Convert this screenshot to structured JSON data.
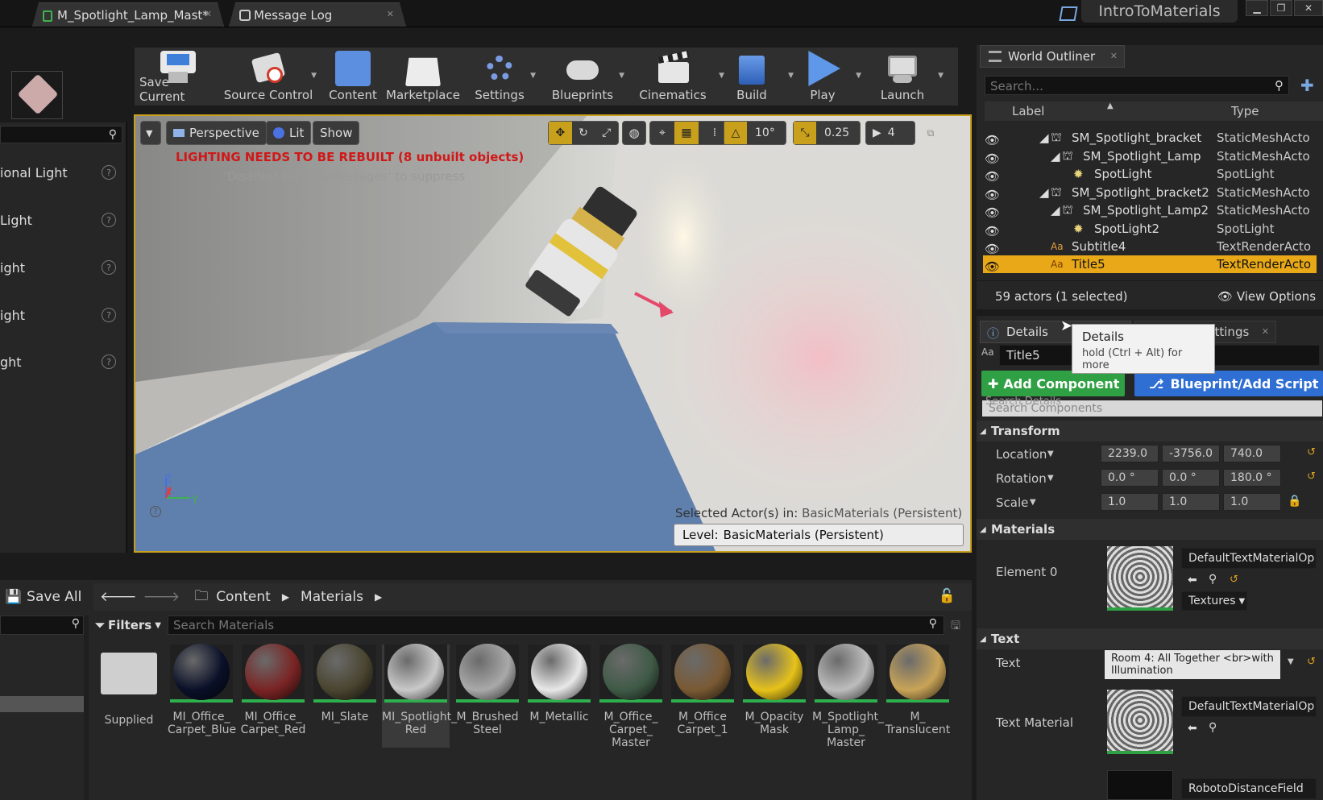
{
  "window": {
    "tabs": [
      {
        "label": "M_Spotlight_Lamp_Mast*"
      },
      {
        "label": "Message Log"
      }
    ],
    "project_name": "IntroToMaterials"
  },
  "toolbar": {
    "buttons": [
      {
        "label": "Save Current",
        "icon": "save-icon"
      },
      {
        "label": "Source Control",
        "icon": "source-control-icon"
      },
      {
        "label": "Content",
        "icon": "content-icon"
      },
      {
        "label": "Marketplace",
        "icon": "marketplace-icon"
      },
      {
        "label": "Settings",
        "icon": "settings-icon"
      },
      {
        "label": "Blueprints",
        "icon": "blueprints-icon"
      },
      {
        "label": "Cinematics",
        "icon": "cinematics-icon"
      },
      {
        "label": "Build",
        "icon": "build-icon"
      },
      {
        "label": "Play",
        "icon": "play-icon"
      },
      {
        "label": "Launch",
        "icon": "launch-icon"
      }
    ]
  },
  "left_panel": {
    "items": [
      "ional Light",
      "Light",
      "ight",
      "ight",
      "ght"
    ]
  },
  "viewport": {
    "perspective_label": "Perspective",
    "lit_label": "Lit",
    "show_label": "Show",
    "angle_snap": "10°",
    "scale_snap": "0.25",
    "camera_speed": "4",
    "warning": "LIGHTING NEEDS TO BE REBUILT (8 unbuilt objects)",
    "suppress_hint": "'DisableAllScreenMessages' to suppress",
    "selected_prefix": "Selected Actor(s) in:",
    "selected_level": "BasicMaterials (Persistent)",
    "level_prefix": "Level:",
    "level_name": "BasicMaterials (Persistent)",
    "axis_labels": {
      "z": "Z",
      "x": "X",
      "y": "Y"
    }
  },
  "outliner": {
    "tab_label": "World Outliner",
    "search_placeholder": "Search...",
    "col_label": "Label",
    "col_type": "Type",
    "rows": [
      {
        "label": "SM_Spotlight_bracket",
        "type": "StaticMeshActo"
      },
      {
        "label": "SM_Spotlight_Lamp",
        "type": "StaticMeshActo"
      },
      {
        "label": "SpotLight",
        "type": "SpotLight"
      },
      {
        "label": "SM_Spotlight_bracket2",
        "type": "StaticMeshActo"
      },
      {
        "label": "SM_Spotlight_Lamp2",
        "type": "StaticMeshActo"
      },
      {
        "label": "SpotLight2",
        "type": "SpotLight"
      },
      {
        "label": "Subtitle4",
        "type": "TextRenderActo"
      },
      {
        "label": "Title5",
        "type": "TextRenderActo"
      }
    ],
    "count": "59 actors (1 selected)",
    "view_options": "View Options"
  },
  "details": {
    "tab_label": "Details",
    "world_settings_label": "World Settings",
    "actor_name": "Title5",
    "tooltip_title": "Details",
    "tooltip_hint": "hold (Ctrl + Alt) for more",
    "add_component": "Add Component",
    "blueprint_script": "Blueprint/Add Script",
    "search_components": "Search Components",
    "search_details": "Search Details",
    "transform_label": "Transform",
    "location_label": "Location",
    "rotation_label": "Rotation",
    "scale_label": "Scale",
    "location": [
      "2239.0",
      "-3756.0",
      "740.0"
    ],
    "rotation": [
      "0.0 °",
      "0.0 °",
      "180.0 °"
    ],
    "scale": [
      "1.0",
      "1.0",
      "1.0"
    ],
    "materials_label": "Materials",
    "element0_label": "Element 0",
    "material_name": "DefaultTextMaterialOp",
    "textures_label": "Textures",
    "text_section": "Text",
    "text_label": "Text",
    "text_value": "Room 4: All Together <br>with Illumination",
    "text_material_label": "Text Material",
    "text_material_name": "DefaultTextMaterialOp",
    "font_name": "RobotoDistanceField"
  },
  "content_browser": {
    "save_all": "Save All",
    "breadcrumb": [
      "Content",
      "Materials"
    ],
    "filters_label": "Filters",
    "search_placeholder": "Search Materials",
    "assets": [
      {
        "label": "Supplied",
        "kind": "folder"
      },
      {
        "label": "MI_Office_ Carpet_Blue",
        "color": "#0a1028"
      },
      {
        "label": "MI_Office_ Carpet_Red",
        "color": "#7a2424"
      },
      {
        "label": "MI_Slate",
        "color": "#4a4530"
      },
      {
        "label": "MI_Spotlight_ Red",
        "color": "#c9c9c9"
      },
      {
        "label": "M_Brushed Steel",
        "color": "#a9a9a9"
      },
      {
        "label": "M_Metallic",
        "color": "#e8e8e8"
      },
      {
        "label": "M_Office_ Carpet_ Master",
        "color": "#3f5a46"
      },
      {
        "label": "M_Office Carpet_1",
        "color": "#7a5a34"
      },
      {
        "label": "M_Opacity Mask",
        "color": "#e6c21a"
      },
      {
        "label": "M_Spotlight_ Lamp_ Master",
        "color": "#bdbdbd"
      },
      {
        "label": "M_ Translucent",
        "color": "#c9a458"
      }
    ]
  }
}
